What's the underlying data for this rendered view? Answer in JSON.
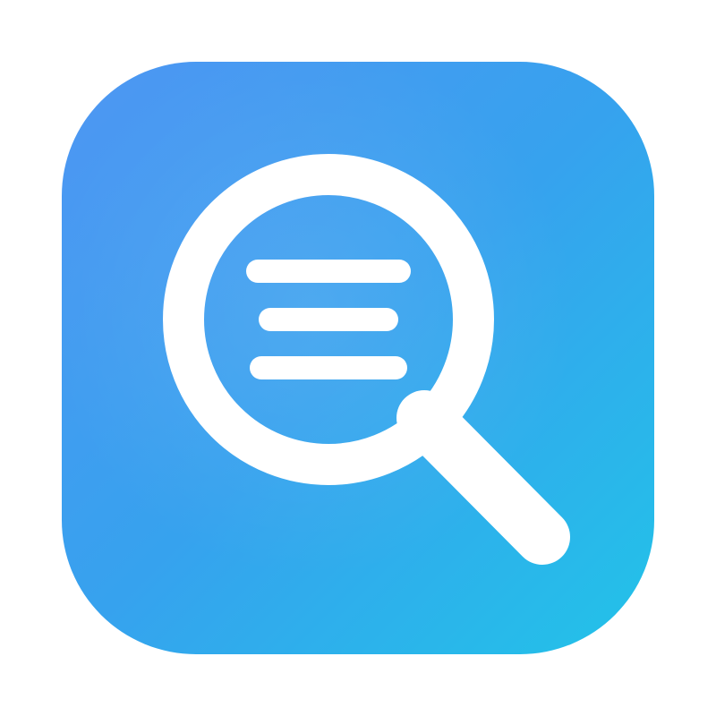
{
  "app_icon": {
    "name": "document-search-app-icon",
    "symbol": "magnifying-glass-with-text-lines",
    "colors": {
      "gradient_start": "#4f96f3",
      "gradient_mid": "#36a2ee",
      "gradient_end": "#22c3e8",
      "glyph": "#ffffff"
    },
    "text_line_count": 3
  }
}
